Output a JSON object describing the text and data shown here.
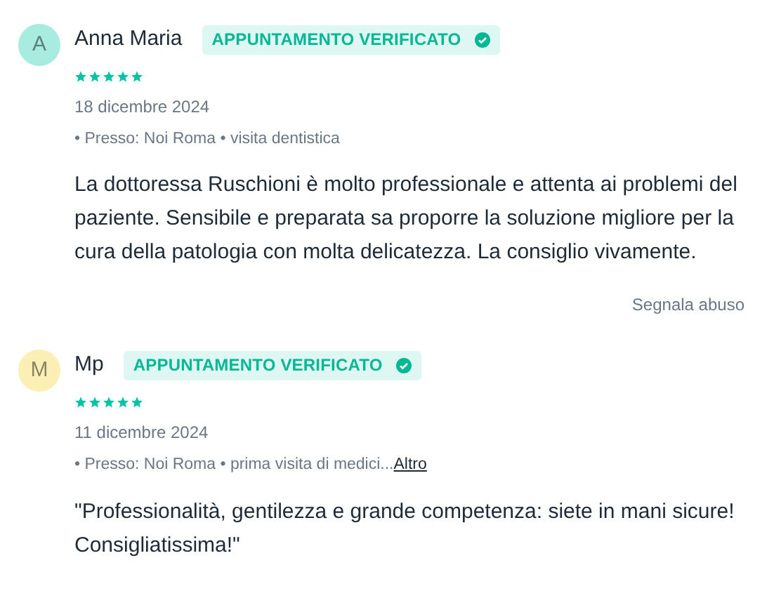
{
  "reviews": [
    {
      "initial": "A",
      "color": "#a8ebdf",
      "name": "Anna Maria",
      "badge": "APPUNTAMENTO VERIFICATO",
      "stars": 5,
      "date": "18 dicembre 2024",
      "details": "• Presso: Noi Roma • visita dentistica",
      "text": "La dottoressa Ruschioni è molto professionale e attenta ai problemi del paziente. Sensibile e preparata sa proporre la soluzione migliore per la cura della patologia con molta delicatezza. La consiglio vivamente.",
      "report": "Segnala abuso"
    },
    {
      "initial": "M",
      "color": "#fcefb4",
      "name": "Mp",
      "badge": "APPUNTAMENTO VERIFICATO",
      "stars": 5,
      "date": "11 dicembre 2024",
      "details": "• Presso: Noi Roma • prima visita di medici...",
      "more": "Altro",
      "text": "\"Professionalità, gentilezza e grande competenza: siete in mani sicure! Consigliatissima!\""
    }
  ]
}
